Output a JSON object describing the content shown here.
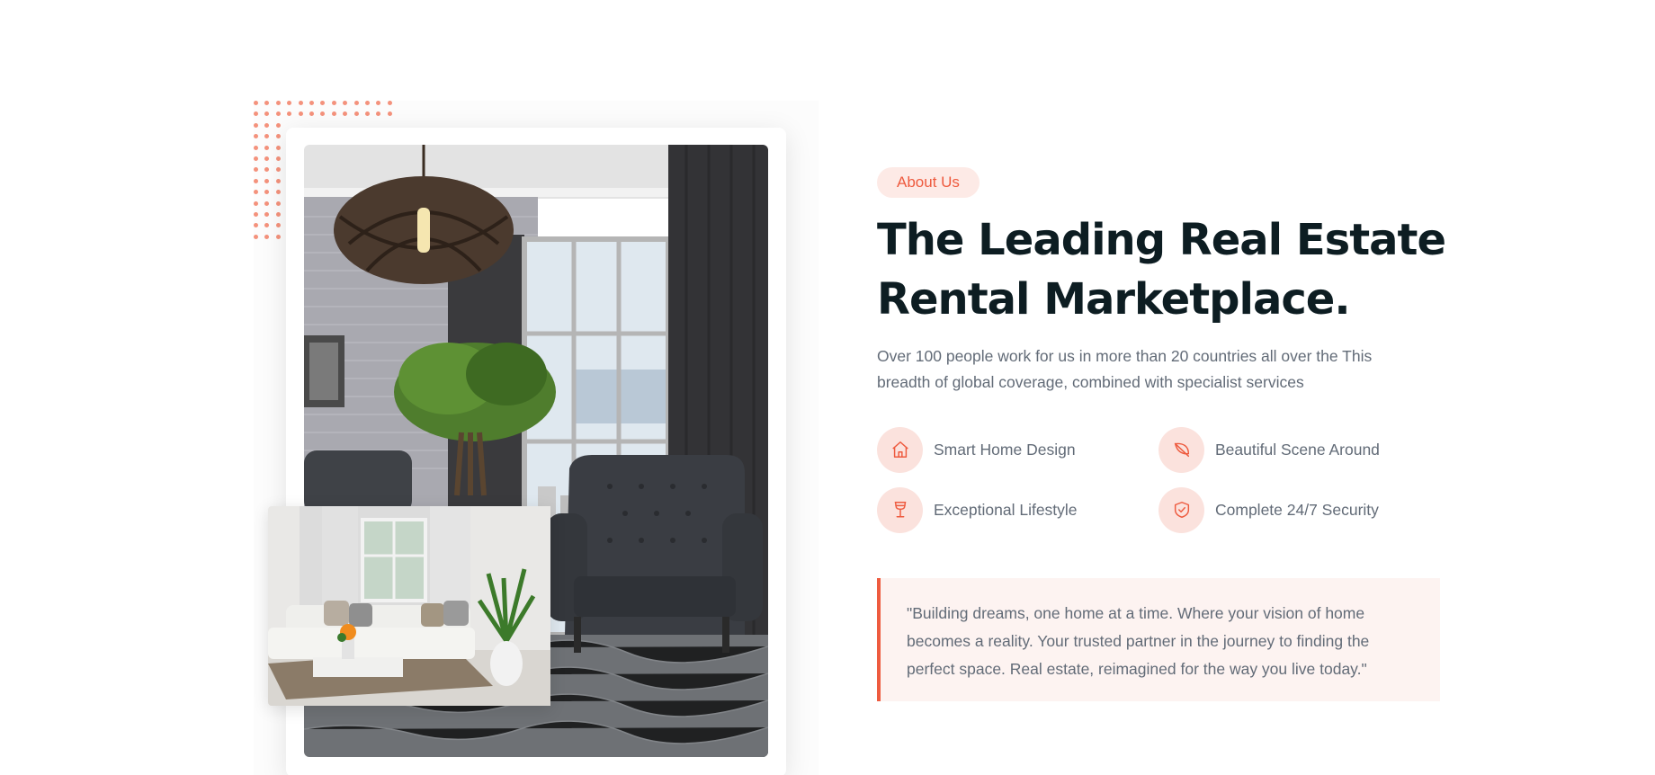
{
  "about": {
    "badge": "About Us",
    "heading_line1": "The Leading Real Estate",
    "heading_line2": "Rental Marketplace.",
    "description": "Over 100 people work for us in more than 20 countries all over the This breadth of global coverage, combined with specialist services",
    "features": [
      {
        "label": "Smart Home Design",
        "icon": "home-icon"
      },
      {
        "label": "Beautiful Scene Around",
        "icon": "leaf-icon"
      },
      {
        "label": "Exceptional Lifestyle",
        "icon": "wine-glass-icon"
      },
      {
        "label": "Complete 24/7 Security",
        "icon": "shield-check-icon"
      }
    ],
    "quote": "\"Building dreams, one home at a time. Where your vision of home becomes a reality. Your trusted partner in the journey to finding the perfect space. Real estate, reimagined for the way you live today.\""
  },
  "colors": {
    "accent": "#ee5b3f",
    "accent_light": "#fdeae6",
    "heading": "#0d1d22",
    "body_text": "#626b77"
  }
}
